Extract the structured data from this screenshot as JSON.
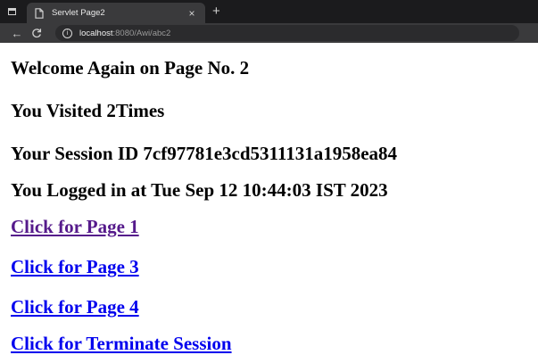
{
  "browser": {
    "tab": {
      "title": "Servlet Page2",
      "close": "×",
      "new_tab": "+"
    },
    "nav": {
      "back": "←",
      "reload": "C"
    },
    "address": {
      "host": "localhost",
      "rest": ":8080/Awi/abc2"
    }
  },
  "page": {
    "heading": "Welcome Again on Page No. 2",
    "visits": "You Visited 2Times",
    "session": "Your Session ID 7cf97781e3cd5311131a1958ea84",
    "login": "You Logged in at Tue Sep 12 10:44:03 IST 2023",
    "links": [
      {
        "label": "Click for Page 1",
        "visited": true
      },
      {
        "label": "Click for Page 3",
        "visited": false
      },
      {
        "label": "Click for Page 4",
        "visited": false
      },
      {
        "label": "Click for Terminate Session",
        "visited": false
      }
    ]
  },
  "colors": {
    "link": "#0000ee",
    "visited_link": "#551a8b",
    "chrome_dark": "#1b1b1d",
    "chrome_toolbar": "#3a3a3c"
  }
}
